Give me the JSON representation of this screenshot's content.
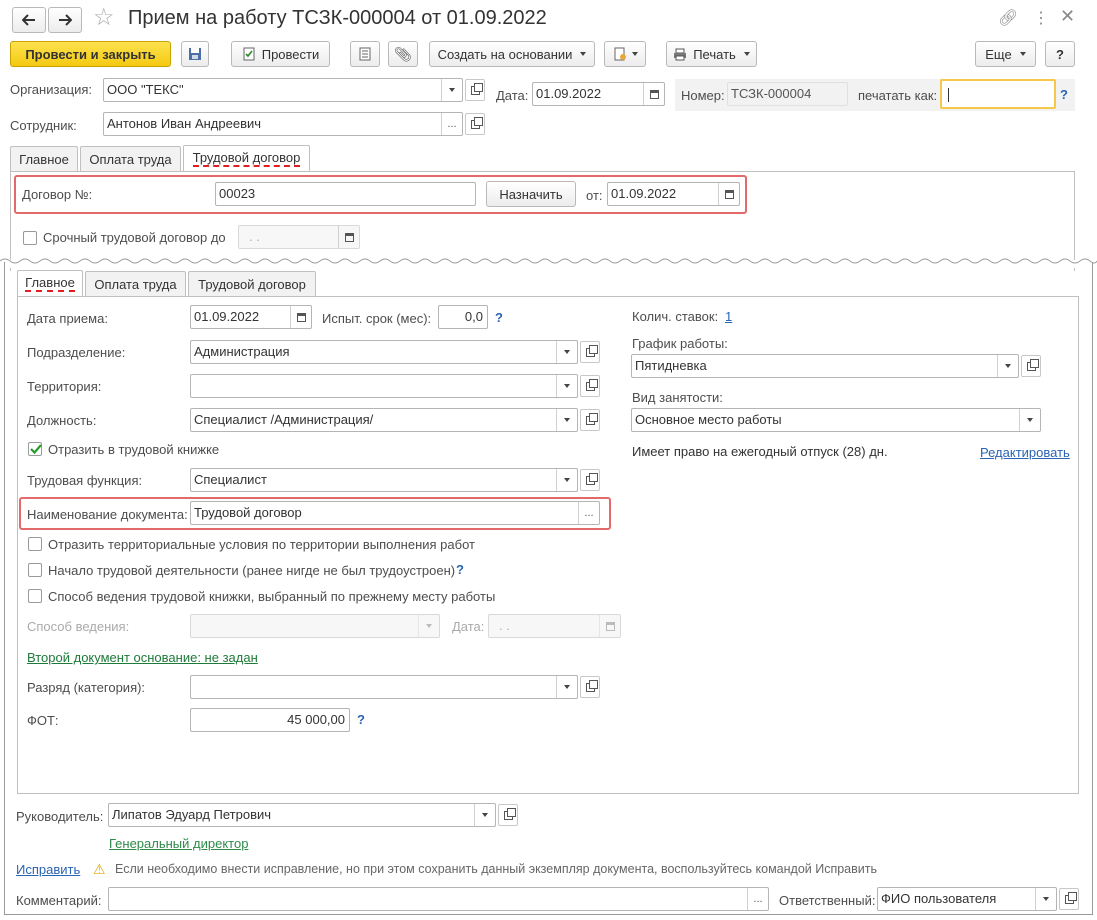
{
  "window": {
    "title": "Прием на работу ТСЗК-000004 от 01.09.2022"
  },
  "toolbar": {
    "post_close": "Провести и закрыть",
    "post": "Провести",
    "create_based": "Создать на основании",
    "print": "Печать",
    "more": "Еще",
    "help": "?"
  },
  "header": {
    "org_label": "Организация:",
    "org_value": "ООО \"ТЕКС\"",
    "date_label": "Дата:",
    "date_value": "01.09.2022",
    "number_label": "Номер:",
    "number_value": "ТСЗК-000004",
    "print_as_label": "печатать как:",
    "print_as_value": "",
    "employee_label": "Сотрудник:",
    "employee_value": "Антонов Иван Андреевич",
    "help": "?"
  },
  "top_tabs": [
    "Главное",
    "Оплата труда",
    "Трудовой договор"
  ],
  "contract": {
    "number_label": "Договор №:",
    "number_value": "00023",
    "assign_btn": "Назначить",
    "from_label": "от:",
    "from_value": "01.09.2022",
    "fixed_term_label": "Срочный трудовой договор до",
    "fixed_term_value": " .  . "
  },
  "inner_tabs": [
    "Главное",
    "Оплата труда",
    "Трудовой договор"
  ],
  "main": {
    "hire_date_label": "Дата приема:",
    "hire_date_value": "01.09.2022",
    "probation_label": "Испыт. срок (мес):",
    "probation_value": "0,0",
    "department_label": "Подразделение:",
    "department_value": "Администрация",
    "territory_label": "Территория:",
    "territory_value": "",
    "position_label": "Должность:",
    "position_value": "Специалист /Администрация/",
    "reflect_workbook_label": "Отразить в трудовой книжке",
    "labor_function_label": "Трудовая функция:",
    "labor_function_value": "Специалист",
    "doc_name_label": "Наименование документа:",
    "doc_name_value": "Трудовой договор",
    "territorial_conditions_label": "Отразить территориальные условия по территории выполнения работ",
    "career_start_label": "Начало трудовой деятельности (ранее нигде не был трудоустроен)",
    "workbook_method_label": "Способ ведения трудовой книжки, выбранный по прежнему месту работы",
    "method_label": "Способ ведения:",
    "method_value": "",
    "method_date_label": "Дата:",
    "method_date_value": " .  . ",
    "second_doc_link": "Второй документ основание: не задан",
    "grade_label": "Разряд (категория):",
    "grade_value": "",
    "fot_label": "ФОТ:",
    "fot_value": "45 000,00",
    "help": "?"
  },
  "right": {
    "rates_label": "Колич. ставок:",
    "rates_value": "1",
    "schedule_label": "График работы:",
    "schedule_value": "Пятидневка",
    "employment_label": "Вид занятости:",
    "employment_value": "Основное место работы",
    "vacation_text": "Имеет право на ежегодный отпуск (28) дн.",
    "edit_link": "Редактировать"
  },
  "footer": {
    "manager_label": "Руководитель:",
    "manager_value": "Липатов Эдуард Петрович",
    "manager_position": "Генеральный директор",
    "fix_link": "Исправить",
    "fix_warning": "Если необходимо внести исправление, но при этом сохранить данный экземпляр документа, воспользуйтесь командой Исправить",
    "comment_label": "Комментарий:",
    "comment_value": "",
    "responsible_label": "Ответственный:",
    "responsible_value": "ФИО пользователя"
  }
}
